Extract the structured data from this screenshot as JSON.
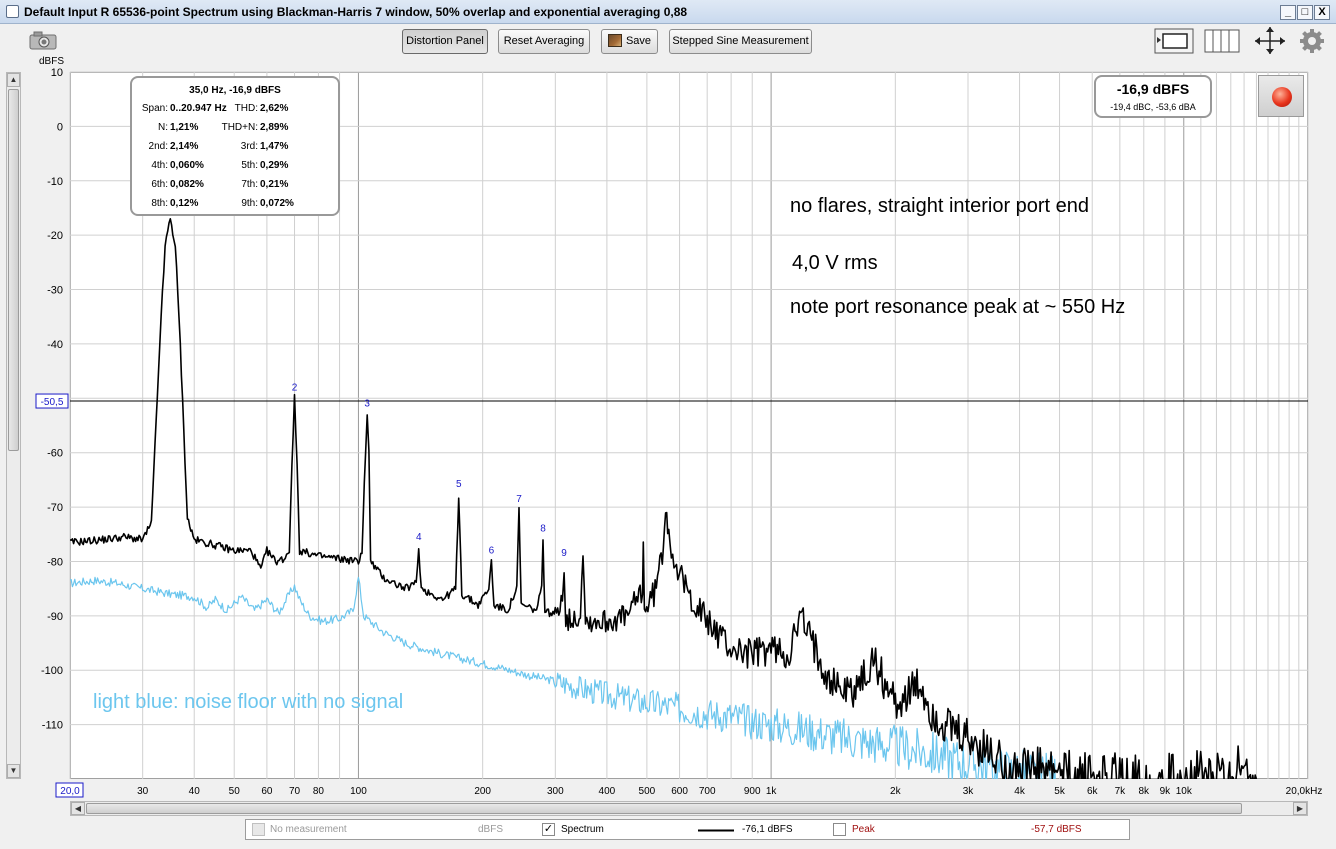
{
  "window": {
    "title": "Default Input R 65536-point Spectrum using Blackman-Harris 7 window, 50% overlap and exponential averaging 0,88",
    "minimize": "_",
    "maximize": "□",
    "close": "X"
  },
  "toolbar": {
    "distortion_panel": "Distortion Panel",
    "reset_averaging": "Reset Averaging",
    "save": "Save",
    "stepped_sine": "Stepped Sine Measurement"
  },
  "y_unit_label": "dBFS",
  "cursor_readout": {
    "header": "35,0 Hz, -16,9 dBFS",
    "rows": [
      {
        "l1": "Span:",
        "v1": "0..20.947 Hz",
        "l2": "THD:",
        "v2": "2,62%"
      },
      {
        "l1": "N:",
        "v1": "1,21%",
        "l2": "THD+N:",
        "v2": "2,89%"
      },
      {
        "l1": "2nd:",
        "v1": "2,14%",
        "l2": "3rd:",
        "v2": "1,47%"
      },
      {
        "l1": "4th:",
        "v1": "0,060%",
        "l2": "5th:",
        "v2": "0,29%"
      },
      {
        "l1": "6th:",
        "v1": "0,082%",
        "l2": "7th:",
        "v2": "0,21%"
      },
      {
        "l1": "8th:",
        "v1": "0,12%",
        "l2": "9th:",
        "v2": "0,072%"
      }
    ]
  },
  "level_meter": {
    "main": "-16,9 dBFS",
    "sub": "-19,4 dBC, -53,6 dBA"
  },
  "annotations": {
    "line1": "no flares, straight interior port end",
    "line2": "4,0 V rms",
    "line3": "note port resonance peak at ~ 550 Hz",
    "noise_note": "light blue: noise floor with no signal"
  },
  "legend": {
    "no_measurement": "No measurement",
    "no_measurement_unit": "dBFS",
    "spectrum": "Spectrum",
    "spectrum_value": "-76,1 dBFS",
    "peak": "Peak",
    "peak_value": "-57,7 dBFS"
  },
  "colors": {
    "spectrum": "#000000",
    "noise_floor": "#6cc6ee",
    "harmonic_labels": "#1a1ac8",
    "grid": "#d0d0d0",
    "grid_major": "#9a9a9a",
    "peak_label": "#a01010"
  },
  "chart_data": {
    "type": "line",
    "xscale": "log",
    "xlim": [
      20,
      20000
    ],
    "ylim": [
      -120,
      10
    ],
    "ylabel": "dBFS",
    "x_tick_labels": [
      {
        "v": 20,
        "t": "20,0",
        "boxed": true
      },
      {
        "v": 30,
        "t": "30"
      },
      {
        "v": 40,
        "t": "40"
      },
      {
        "v": 50,
        "t": "50"
      },
      {
        "v": 60,
        "t": "60"
      },
      {
        "v": 70,
        "t": "70"
      },
      {
        "v": 80,
        "t": "80"
      },
      {
        "v": 100,
        "t": "100"
      },
      {
        "v": 200,
        "t": "200"
      },
      {
        "v": 300,
        "t": "300"
      },
      {
        "v": 400,
        "t": "400"
      },
      {
        "v": 500,
        "t": "500"
      },
      {
        "v": 600,
        "t": "600"
      },
      {
        "v": 700,
        "t": "700"
      },
      {
        "v": 900,
        "t": "900"
      },
      {
        "v": 1000,
        "t": "1k"
      },
      {
        "v": 2000,
        "t": "2k"
      },
      {
        "v": 3000,
        "t": "3k"
      },
      {
        "v": 4000,
        "t": "4k"
      },
      {
        "v": 5000,
        "t": "5k"
      },
      {
        "v": 6000,
        "t": "6k"
      },
      {
        "v": 7000,
        "t": "7k"
      },
      {
        "v": 8000,
        "t": "8k"
      },
      {
        "v": 9000,
        "t": "9k"
      },
      {
        "v": 10000,
        "t": "10k"
      },
      {
        "v": 20000,
        "t": "20,0kHz"
      }
    ],
    "y_ticks": [
      10,
      0,
      -10,
      -20,
      -30,
      -40,
      -60,
      -70,
      -80,
      -90,
      -100,
      -110
    ],
    "cursor": {
      "y": -50.5,
      "label": "-50,5"
    },
    "harmonic_markers": [
      {
        "n": "2",
        "f": 70,
        "db": -50.0
      },
      {
        "n": "3",
        "f": 105,
        "db": -53.0
      },
      {
        "n": "4",
        "f": 140,
        "db": -77.5
      },
      {
        "n": "5",
        "f": 175,
        "db": -67.8
      },
      {
        "n": "6",
        "f": 210,
        "db": -80.0
      },
      {
        "n": "7",
        "f": 245,
        "db": -70.5
      },
      {
        "n": "8",
        "f": 280,
        "db": -76.0
      },
      {
        "n": "9",
        "f": 315,
        "db": -80.5
      }
    ],
    "series": [
      {
        "name": "Spectrum",
        "points": [
          [
            20,
            -76.5
          ],
          [
            24,
            -76
          ],
          [
            27,
            -75.5
          ],
          [
            30,
            -76
          ],
          [
            31.5,
            -73
          ],
          [
            33,
            -40
          ],
          [
            34,
            -22
          ],
          [
            35,
            -16.9
          ],
          [
            36,
            -22
          ],
          [
            37,
            -40
          ],
          [
            38.5,
            -72
          ],
          [
            40,
            -76
          ],
          [
            45,
            -77
          ],
          [
            50,
            -78
          ],
          [
            55,
            -78
          ],
          [
            58,
            -81.5
          ],
          [
            60,
            -78
          ],
          [
            63,
            -80
          ],
          [
            66,
            -79.5
          ],
          [
            68,
            -78
          ],
          [
            69,
            -62
          ],
          [
            70,
            -50
          ],
          [
            71,
            -62
          ],
          [
            72,
            -78
          ],
          [
            80,
            -79
          ],
          [
            90,
            -79.5
          ],
          [
            100,
            -80
          ],
          [
            102,
            -78
          ],
          [
            104,
            -60
          ],
          [
            105,
            -53
          ],
          [
            106,
            -60
          ],
          [
            107,
            -80
          ],
          [
            115,
            -83
          ],
          [
            130,
            -85
          ],
          [
            138,
            -84
          ],
          [
            140,
            -77.5
          ],
          [
            142,
            -85
          ],
          [
            160,
            -87
          ],
          [
            172,
            -85
          ],
          [
            175,
            -67.8
          ],
          [
            178,
            -86
          ],
          [
            195,
            -88
          ],
          [
            207,
            -85
          ],
          [
            210,
            -80
          ],
          [
            213,
            -88
          ],
          [
            230,
            -89
          ],
          [
            242,
            -85
          ],
          [
            245,
            -70.5
          ],
          [
            248,
            -88
          ],
          [
            270,
            -89
          ],
          [
            278,
            -85
          ],
          [
            280,
            -76
          ],
          [
            283,
            -89
          ],
          [
            300,
            -90
          ],
          [
            312,
            -86
          ],
          [
            315,
            -80.5
          ],
          [
            318,
            -91
          ],
          [
            345,
            -90
          ],
          [
            350,
            -77
          ],
          [
            355,
            -91
          ],
          [
            400,
            -91
          ],
          [
            450,
            -90
          ],
          [
            488,
            -85
          ],
          [
            490,
            -77
          ],
          [
            493,
            -89
          ],
          [
            520,
            -86
          ],
          [
            545,
            -79
          ],
          [
            555,
            -69
          ],
          [
            565,
            -75
          ],
          [
            590,
            -81
          ],
          [
            620,
            -85
          ],
          [
            700,
            -91
          ],
          [
            800,
            -96
          ],
          [
            900,
            -97
          ],
          [
            1000,
            -96
          ],
          [
            1100,
            -97
          ],
          [
            1150,
            -93
          ],
          [
            1180,
            -90
          ],
          [
            1220,
            -93
          ],
          [
            1300,
            -97
          ],
          [
            1400,
            -102
          ],
          [
            1550,
            -104
          ],
          [
            1700,
            -101
          ],
          [
            1780,
            -98
          ],
          [
            1850,
            -101
          ],
          [
            2000,
            -106
          ],
          [
            2200,
            -104
          ],
          [
            2300,
            -103
          ],
          [
            2450,
            -108
          ],
          [
            2700,
            -111
          ],
          [
            3000,
            -113
          ],
          [
            3500,
            -116
          ],
          [
            4000,
            -118
          ],
          [
            5000,
            -119
          ],
          [
            6000,
            -119.5
          ],
          [
            8000,
            -120
          ],
          [
            10000,
            -120
          ],
          [
            13000,
            -119.5
          ],
          [
            14500,
            -118
          ],
          [
            14800,
            -117
          ],
          [
            15000,
            -120
          ]
        ]
      },
      {
        "name": "Noise floor (no signal)",
        "points": [
          [
            20,
            -84
          ],
          [
            23,
            -83.5
          ],
          [
            26,
            -84
          ],
          [
            30,
            -85
          ],
          [
            35,
            -86
          ],
          [
            40,
            -86.5
          ],
          [
            43,
            -88.5
          ],
          [
            45,
            -87
          ],
          [
            48,
            -89
          ],
          [
            52,
            -86.5
          ],
          [
            56,
            -89
          ],
          [
            60,
            -87
          ],
          [
            64,
            -89.5
          ],
          [
            68,
            -86
          ],
          [
            70,
            -84.5
          ],
          [
            72,
            -87
          ],
          [
            76,
            -90
          ],
          [
            82,
            -91
          ],
          [
            90,
            -90.5
          ],
          [
            97,
            -89
          ],
          [
            100,
            -83
          ],
          [
            103,
            -90
          ],
          [
            115,
            -93
          ],
          [
            130,
            -95
          ],
          [
            150,
            -96.5
          ],
          [
            180,
            -98
          ],
          [
            220,
            -99.5
          ],
          [
            260,
            -101
          ],
          [
            300,
            -102
          ],
          [
            350,
            -103.5
          ],
          [
            400,
            -104.5
          ],
          [
            500,
            -106
          ],
          [
            600,
            -107
          ],
          [
            700,
            -108
          ],
          [
            800,
            -108.5
          ],
          [
            900,
            -109.5
          ],
          [
            1000,
            -110
          ],
          [
            1200,
            -111
          ],
          [
            1500,
            -112.5
          ],
          [
            2000,
            -114
          ],
          [
            2500,
            -115.5
          ],
          [
            3000,
            -117
          ],
          [
            4000,
            -119
          ],
          [
            5000,
            -120
          ]
        ]
      }
    ]
  }
}
